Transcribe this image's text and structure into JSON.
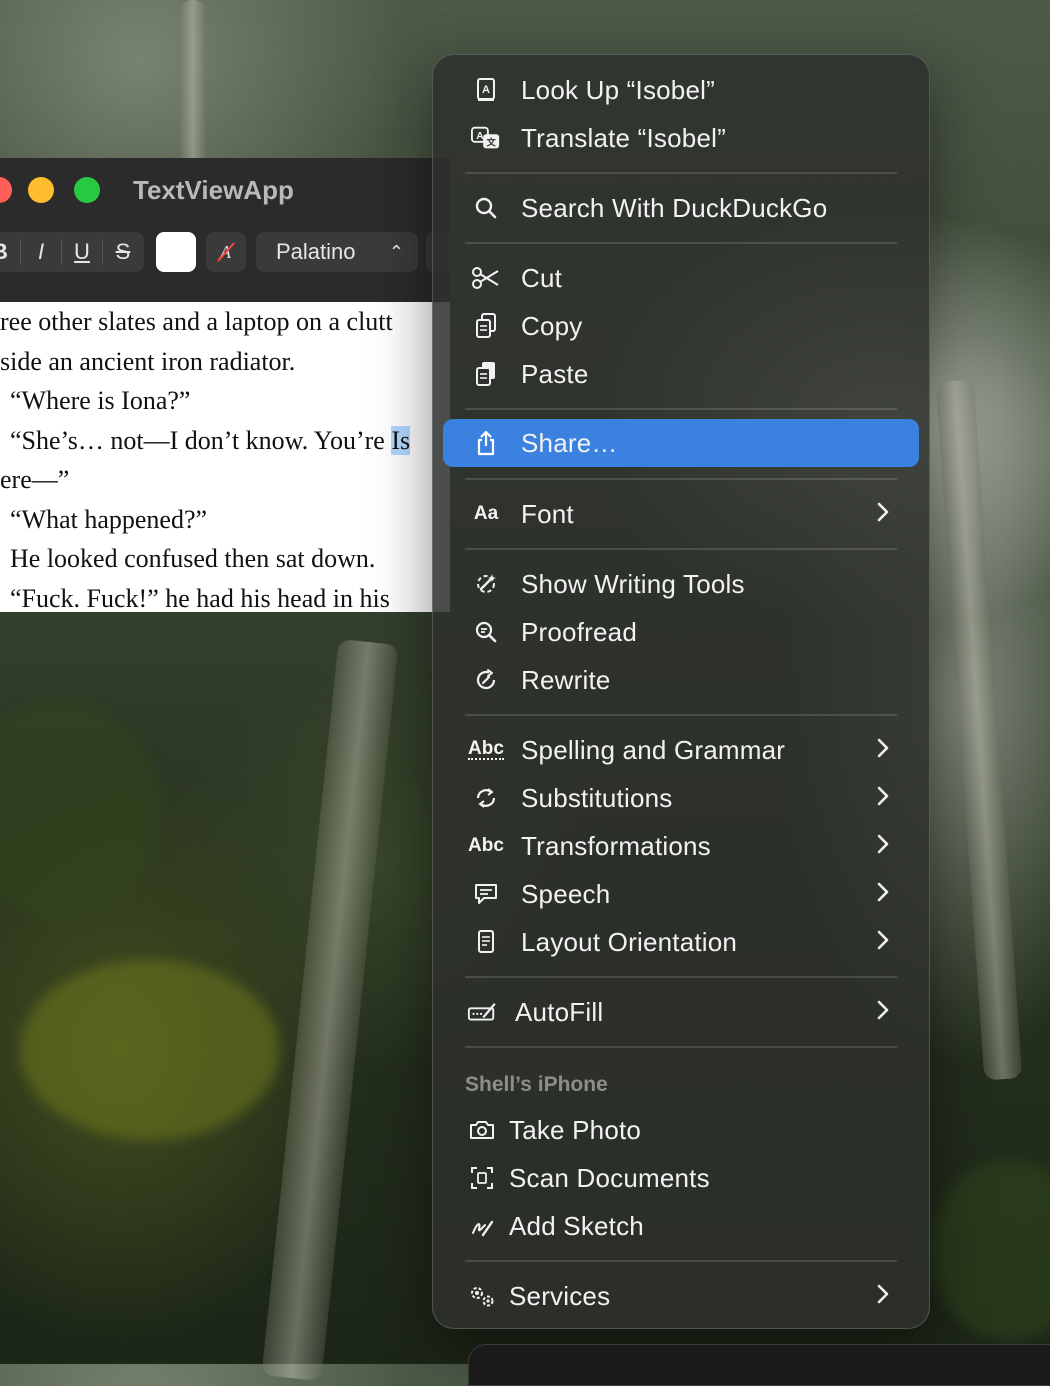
{
  "window": {
    "title": "TextViewApp",
    "toolbar": {
      "bold": "B",
      "italic": "I",
      "underline": "U",
      "strikethrough": "S",
      "font_name": "Palatino"
    }
  },
  "document": {
    "lines": [
      "ree other slates and a laptop on a clutt",
      "side an ancient iron radiator.",
      "“Where is Iona?”",
      "“She’s… not—I don’t know. You’re ",
      "ere—”",
      "“What happened?”",
      "He looked confused then sat down.",
      "“Fuck. Fuck!” he had his head in his"
    ],
    "selected_fragment": "Is"
  },
  "menu": {
    "look_up": "Look Up “Isobel”",
    "translate": "Translate “Isobel”",
    "search": "Search With DuckDuckGo",
    "cut": "Cut",
    "copy": "Copy",
    "paste": "Paste",
    "share": "Share…",
    "font": "Font",
    "font_icon": "Aa",
    "show_writing_tools": "Show Writing Tools",
    "proofread": "Proofread",
    "rewrite": "Rewrite",
    "spelling": "Spelling and Grammar",
    "substitutions": "Substitutions",
    "transformations": "Transformations",
    "speech": "Speech",
    "layout_orientation": "Layout Orientation",
    "autofill": "AutoFill",
    "iphone_section": "Shell’s iPhone",
    "take_photo": "Take Photo",
    "scan_documents": "Scan Documents",
    "add_sketch": "Add Sketch",
    "services": "Services",
    "abc_icon": "Abc",
    "highlight_color": "#3b82e0"
  }
}
